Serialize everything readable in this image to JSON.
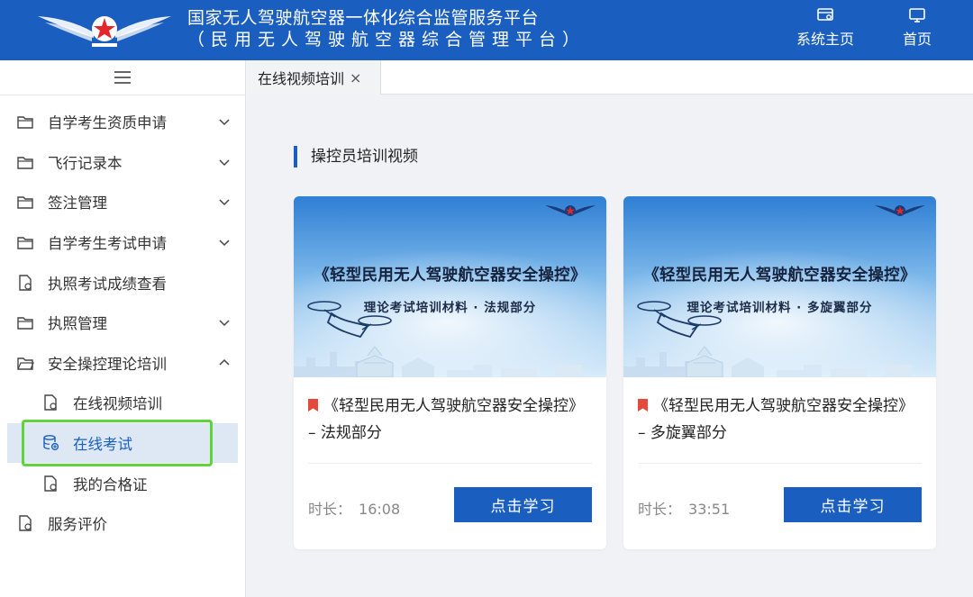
{
  "header": {
    "title_main": "国家无人驾驶航空器一体化综合监管服务平台",
    "title_sub": "（民用无人驾驶航空器综合管理平台）",
    "nav": [
      {
        "label": "系统主页",
        "icon": "system-home-icon"
      },
      {
        "label": "首页",
        "icon": "monitor-icon"
      }
    ]
  },
  "sidebar": {
    "toggle_icon": "hamburger-icon",
    "items": [
      {
        "label": "自学考生资质申请",
        "icon": "folder-icon",
        "expandable": true
      },
      {
        "label": "飞行记录本",
        "icon": "folder-icon",
        "expandable": true
      },
      {
        "label": "签注管理",
        "icon": "folder-icon",
        "expandable": true
      },
      {
        "label": "自学考生考试申请",
        "icon": "folder-icon",
        "expandable": true
      },
      {
        "label": "执照考试成绩查看",
        "icon": "document-icon",
        "expandable": false
      },
      {
        "label": "执照管理",
        "icon": "folder-icon",
        "expandable": true
      },
      {
        "label": "安全操控理论培训",
        "icon": "folder-open-icon",
        "expandable": true,
        "expanded": true
      },
      {
        "label": "在线视频培训",
        "icon": "document-icon",
        "sub": true
      },
      {
        "label": "在线考试",
        "icon": "database-icon",
        "sub": true,
        "active": true
      },
      {
        "label": "我的合格证",
        "icon": "document-icon",
        "sub": true
      },
      {
        "label": "服务评价",
        "icon": "document-icon",
        "expandable": false
      }
    ]
  },
  "tabs": [
    {
      "label": "在线视频培训",
      "close": "×"
    }
  ],
  "section_title": "操控员培训视频",
  "cards": [
    {
      "thumb_title": "《轻型民用无人驾驶航空器安全操控》",
      "thumb_sub": "理论考试培训材料 · 法规部分",
      "title": "《轻型民用无人驾驶航空器安全操控》 – 法规部分",
      "duration_label": "时长：",
      "duration": "16:08",
      "button": "点击学习"
    },
    {
      "thumb_title": "《轻型民用无人驾驶航空器安全操控》",
      "thumb_sub": "理论考试培训材料 · 多旋翼部分",
      "title": "《轻型民用无人驾驶航空器安全操控》 – 多旋翼部分",
      "duration_label": "时长：",
      "duration": "33:51",
      "button": "点击学习"
    }
  ],
  "colors": {
    "primary": "#1a5fbf",
    "highlight": "#5fd33a",
    "flag": "#e34a3c"
  }
}
